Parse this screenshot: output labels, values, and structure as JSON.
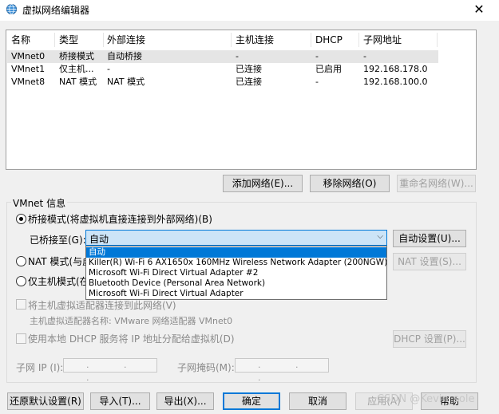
{
  "window": {
    "title": "虚拟网络编辑器",
    "close_glyph": "✕"
  },
  "table": {
    "headers": [
      "名称",
      "类型",
      "外部连接",
      "主机连接",
      "DHCP",
      "子网地址"
    ],
    "rows": [
      [
        "VMnet0",
        "桥接模式",
        "自动桥接",
        "-",
        "-",
        "-"
      ],
      [
        "VMnet1",
        "仅主机...",
        "-",
        "已连接",
        "已启用",
        "192.168.178.0"
      ],
      [
        "VMnet8",
        "NAT 模式",
        "NAT 模式",
        "已连接",
        "-",
        "192.168.100.0"
      ]
    ]
  },
  "net_buttons": {
    "add": "添加网络(E)...",
    "remove": "移除网络(O)",
    "rename": "重命名网络(W)..."
  },
  "vmnet_info": {
    "group_label": "VMnet 信息",
    "bridged_label": "桥接模式(将虚拟机直接连接到外部网络)(B)",
    "bridged_to_label": "已桥接至(G):",
    "bridged_value": "自动",
    "auto_settings": "自动设置(U)...",
    "nat_label": "NAT 模式(与虚",
    "nat_settings": "NAT 设置(S)...",
    "hostonly_label": "仅主机模式(在",
    "connect_adapter_label": "将主机虚拟适配器连接到此网络(V)",
    "adapter_name_label": "主机虚拟适配器名称: VMware 网络适配器 VMnet0",
    "dhcp_label": "使用本地 DHCP 服务将 IP 地址分配给虚拟机(D)",
    "dhcp_settings": "DHCP 设置(P)...",
    "subnet_ip_label": "子网 IP (I):",
    "subnet_mask_label": "子网掩码(M):",
    "ip_placeholder": ". . ."
  },
  "dropdown_options": [
    "自动",
    "Killer(R) Wi-Fi 6 AX1650x 160MHz Wireless Network Adapter (200NGW)",
    "Microsoft Wi-Fi Direct Virtual Adapter #2",
    "Bluetooth Device (Personal Area Network)",
    "Microsoft Wi-Fi Direct Virtual Adapter"
  ],
  "footer": {
    "restore": "还原默认设置(R)",
    "import": "导入(T)...",
    "export": "导出(X)...",
    "ok": "确定",
    "cancel": "取消",
    "apply": "应用(A)",
    "help": "帮助"
  },
  "watermark": "CSDN @Kevin_sole",
  "colors": {
    "accent": "#0078d7",
    "selection": "#cce4f7"
  }
}
